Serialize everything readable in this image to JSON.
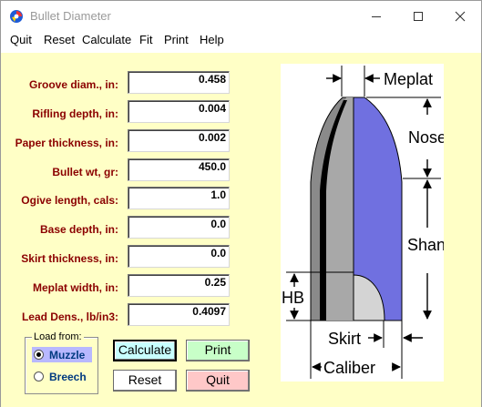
{
  "window": {
    "title": "Bullet Diameter",
    "controls": {
      "minimize": "minimize-icon",
      "maximize": "maximize-icon",
      "close": "close-icon"
    }
  },
  "menu": [
    "Quit",
    "Reset",
    "Calculate",
    "Fit",
    "Print",
    "Help"
  ],
  "fields": [
    {
      "label": "Groove diam., in:",
      "value": "0.458"
    },
    {
      "label": "Rifling depth, in:",
      "value": "0.004"
    },
    {
      "label": "Paper thickness, in:",
      "value": "0.002"
    },
    {
      "label": "Bullet wt, gr:",
      "value": "450.0"
    },
    {
      "label": "Ogive length, cals:",
      "value": "1.0"
    },
    {
      "label": "Base depth, in:",
      "value": "0.0"
    },
    {
      "label": "Skirt thickness, in:",
      "value": "0.0"
    },
    {
      "label": "Meplat width, in:",
      "value": "0.25"
    },
    {
      "label": "Lead Dens., lb/in3:",
      "value": "0.4097"
    }
  ],
  "load_from": {
    "title": "Load from:",
    "options": [
      {
        "label": "Muzzle",
        "selected": true
      },
      {
        "label": "Breech",
        "selected": false
      }
    ]
  },
  "buttons": {
    "calculate": "Calculate",
    "print": "Print",
    "reset": "Reset",
    "quit": "Quit"
  },
  "diagram": {
    "labels": {
      "meplat": "Meplat",
      "nose": "Nose",
      "shank": "Shank",
      "hb": "HB",
      "skirt": "Skirt",
      "caliber": "Caliber"
    }
  },
  "colors": {
    "client_bg": "#ffffc6",
    "label_text": "#8b0000",
    "bullet_body": "#7070e0",
    "bullet_grey": "#8a8a8a",
    "calc_btn": "#c8ffff",
    "print_btn": "#c8ffc8",
    "quit_btn": "#ffc8c8"
  }
}
